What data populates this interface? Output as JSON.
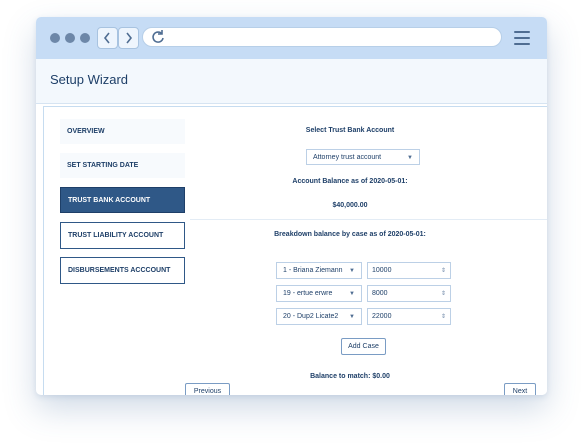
{
  "browser": {
    "back_icon": "chevron-left-icon",
    "forward_icon": "chevron-right-icon",
    "reload_icon": "reload-icon",
    "menu_icon": "hamburger-icon"
  },
  "header": {
    "title": "Setup Wizard"
  },
  "sidebar": {
    "items": [
      {
        "label": "OVERVIEW"
      },
      {
        "label": "SET STARTING DATE"
      },
      {
        "label": "TRUST BANK ACCOUNT"
      },
      {
        "label": "TRUST LIABILITY ACCOUNT"
      },
      {
        "label": "DISBURSEMENTS ACCCOUNT"
      }
    ]
  },
  "main": {
    "select_account_label": "Select Trust Bank Account",
    "account_select_value": "Attorney trust account",
    "balance_label": "Account Balance as of 2020-05-01:",
    "balance_value": "$40,000.00",
    "breakdown_label": "Breakdown balance by case as of 2020-05-01:",
    "cases": [
      {
        "case": "1 - Briana Ziemann",
        "amount": "10000"
      },
      {
        "case": "19 - ertue erwre",
        "amount": "8000"
      },
      {
        "case": "20 - Dup2 Licate2",
        "amount": "22000"
      }
    ],
    "add_case_label": "Add Case",
    "balance_to_match": "Balance to match: $0.00",
    "previous_label": "Previous",
    "next_label": "Next"
  },
  "colors": {
    "chrome": "#c6dcf5",
    "accent": "#2f5887",
    "text": "#1e3f68"
  }
}
